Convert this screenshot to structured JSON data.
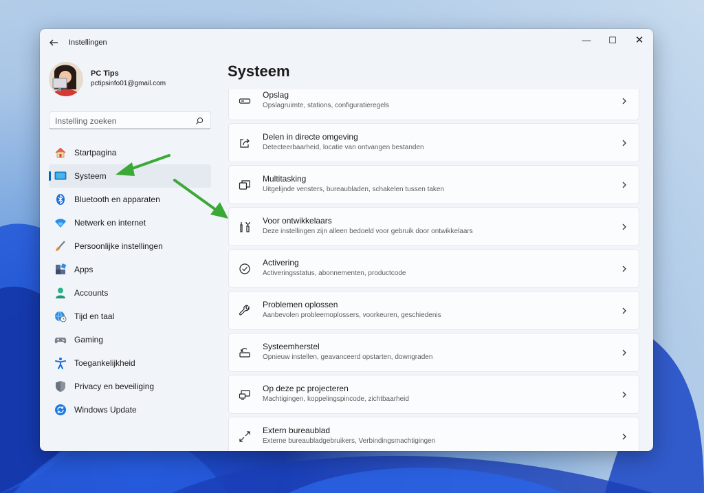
{
  "window": {
    "title": "Instellingen",
    "controls": {
      "minimize": "—",
      "maximize": "☐",
      "close": "✕"
    }
  },
  "profile": {
    "name": "PC Tips",
    "email": "pctipsinfo01@gmail.com"
  },
  "search": {
    "placeholder": "Instelling zoeken"
  },
  "sidebar": {
    "items": [
      {
        "label": "Startpagina",
        "icon": "home-icon"
      },
      {
        "label": "Systeem",
        "icon": "monitor-icon",
        "active": true
      },
      {
        "label": "Bluetooth en apparaten",
        "icon": "bluetooth-icon"
      },
      {
        "label": "Netwerk en internet",
        "icon": "wifi-icon"
      },
      {
        "label": "Persoonlijke instellingen",
        "icon": "brush-icon"
      },
      {
        "label": "Apps",
        "icon": "apps-icon"
      },
      {
        "label": "Accounts",
        "icon": "person-icon"
      },
      {
        "label": "Tijd en taal",
        "icon": "globe-clock-icon"
      },
      {
        "label": "Gaming",
        "icon": "gamepad-icon"
      },
      {
        "label": "Toegankelijkheid",
        "icon": "accessibility-icon"
      },
      {
        "label": "Privacy en beveiliging",
        "icon": "shield-icon"
      },
      {
        "label": "Windows Update",
        "icon": "update-icon"
      }
    ]
  },
  "main": {
    "title": "Systeem",
    "cards": [
      {
        "title": "Opslag",
        "subtitle": "Opslagruimte, stations, configuratieregels",
        "icon": "storage-icon"
      },
      {
        "title": "Delen in directe omgeving",
        "subtitle": "Detecteerbaarheid, locatie van ontvangen bestanden",
        "icon": "share-icon"
      },
      {
        "title": "Multitasking",
        "subtitle": "Uitgelijnde vensters, bureaubladen, schakelen tussen taken",
        "icon": "multitasking-icon"
      },
      {
        "title": "Voor ontwikkelaars",
        "subtitle": "Deze instellingen zijn alleen bedoeld voor gebruik door ontwikkelaars",
        "icon": "developer-tools-icon"
      },
      {
        "title": "Activering",
        "subtitle": "Activeringsstatus, abonnementen, productcode",
        "icon": "check-circle-icon"
      },
      {
        "title": "Problemen oplossen",
        "subtitle": "Aanbevolen probleemoplossers, voorkeuren, geschiedenis",
        "icon": "wrench-icon"
      },
      {
        "title": "Systeemherstel",
        "subtitle": "Opnieuw instellen, geavanceerd opstarten, downgraden",
        "icon": "recovery-icon"
      },
      {
        "title": "Op deze pc projecteren",
        "subtitle": "Machtigingen, koppelingspincode, zichtbaarheid",
        "icon": "projector-icon"
      },
      {
        "title": "Extern bureaublad",
        "subtitle": "Externe bureaubladgebruikers, Verbindingsmachtigingen",
        "icon": "remote-desktop-icon"
      }
    ]
  },
  "colors": {
    "accent": "#0067c0",
    "annotation_arrow": "#3aa935",
    "window_bg": "#f1f4f9",
    "card_bg": "#fbfcfe"
  }
}
